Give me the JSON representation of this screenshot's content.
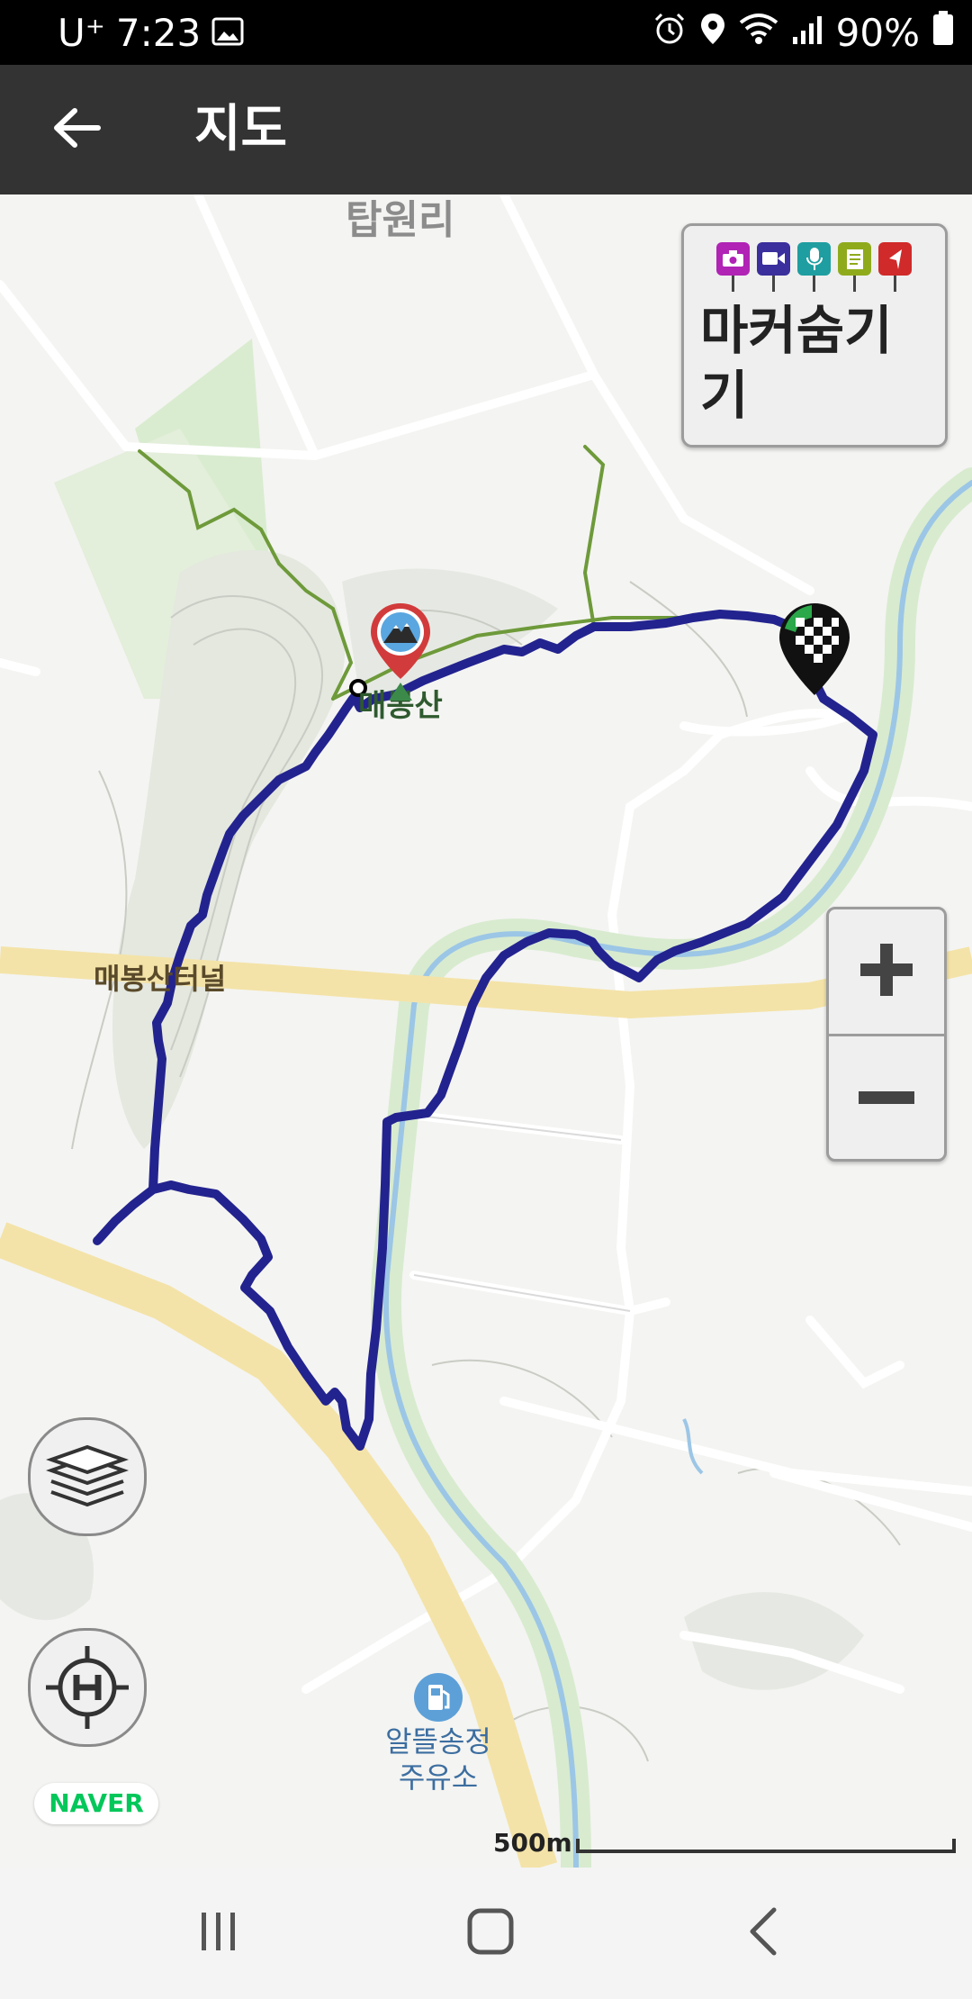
{
  "status_bar": {
    "carrier": "U⁺",
    "time": "7:23",
    "battery": "90%",
    "icons": [
      "image-icon",
      "alarm-icon",
      "location-icon",
      "wifi-icon",
      "signal-icon",
      "battery-icon"
    ]
  },
  "app_bar": {
    "title": "지도",
    "back_icon": "arrow-left-icon"
  },
  "map": {
    "labels": {
      "village": "탑원리",
      "mountain": "매봉산",
      "tunnel": "매봉산터널",
      "gas_station_line1": "알뜰송정",
      "gas_station_line2": "주유소"
    },
    "marker_toggle": {
      "label": "마커숨기기",
      "pin_icons": [
        "camera-icon",
        "video-icon",
        "microphone-icon",
        "memo-icon",
        "flag-icon"
      ],
      "pin_colors": [
        "#b023b5",
        "#3a2f9c",
        "#1e9ea0",
        "#8fab1c",
        "#d02a2a"
      ]
    },
    "zoom": {
      "in_icon": "plus-icon",
      "out_icon": "minus-icon"
    },
    "layer_button_icon": "layers-icon",
    "locate_button_icon": "crosshair-h-icon",
    "provider_logo": "NAVER",
    "scale_label": "500m",
    "track_color": "#23238f",
    "trail_color": "#6e9a3a"
  },
  "nav_bar": {
    "icons": [
      "recent-apps-icon",
      "home-icon",
      "back-icon"
    ]
  }
}
